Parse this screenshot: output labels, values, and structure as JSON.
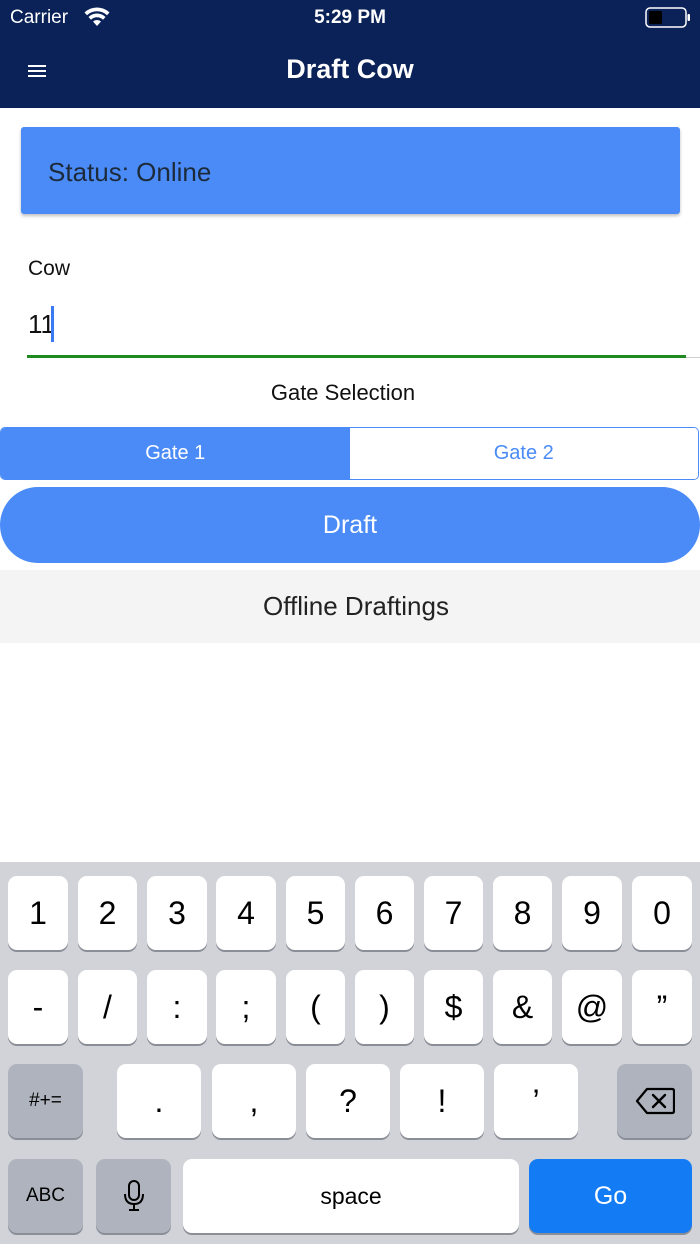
{
  "status_bar": {
    "carrier": "Carrier",
    "time": "5:29 PM"
  },
  "header": {
    "title": "Draft Cow",
    "menu_icon": "hamburger-menu-icon"
  },
  "status_card": {
    "text": "Status: Online",
    "color": "#4a8bf7"
  },
  "cow_field": {
    "label": "Cow",
    "value": "11"
  },
  "gate": {
    "title": "Gate Selection",
    "options": [
      "Gate 1",
      "Gate 2"
    ],
    "selected": "Gate 1"
  },
  "draft_button": {
    "label": "Draft"
  },
  "offline": {
    "label": "Offline Draftings"
  },
  "keyboard": {
    "row1": [
      "1",
      "2",
      "3",
      "4",
      "5",
      "6",
      "7",
      "8",
      "9",
      "0"
    ],
    "row2": [
      "-",
      "/",
      ":",
      ";",
      "(",
      ")",
      "$",
      "&",
      "@",
      "”"
    ],
    "row3": [
      ".",
      ",",
      "?",
      "!",
      "’"
    ],
    "symbols_key": "#+=",
    "abc_key": "ABC",
    "space_key": "space",
    "go_key": "Go",
    "accent_color": "#137cf5"
  }
}
